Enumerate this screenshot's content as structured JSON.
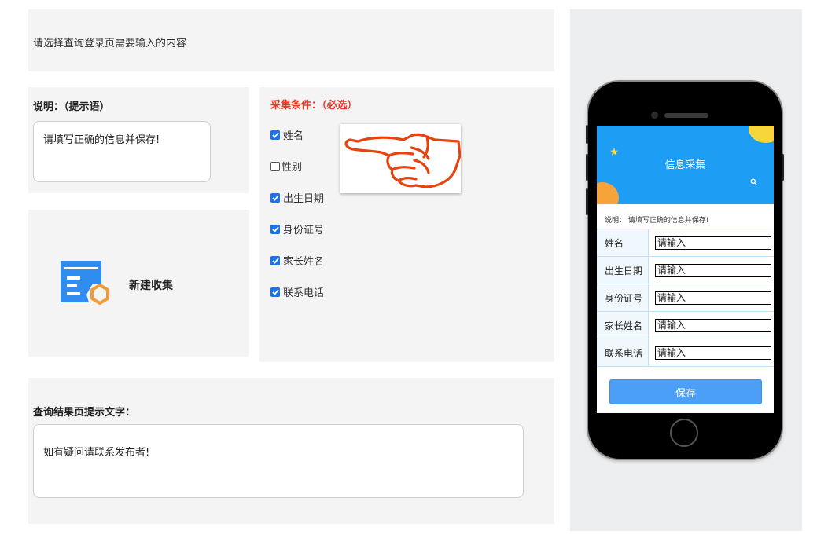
{
  "top": {
    "prompt": "请选择查询登录页需要输入的内容"
  },
  "description": {
    "label": "说明：（提示语）",
    "value": "请填写正确的信息并保存!"
  },
  "new_collection": {
    "label": "新建收集",
    "icon": "form-edit-icon"
  },
  "conditions": {
    "title": "采集条件：（必选）",
    "items": [
      {
        "label": "姓名",
        "checked": true
      },
      {
        "label": "性别",
        "checked": false
      },
      {
        "label": "出生日期",
        "checked": true
      },
      {
        "label": "身份证号",
        "checked": true
      },
      {
        "label": "家长姓名",
        "checked": true
      },
      {
        "label": "联系电话",
        "checked": true
      }
    ]
  },
  "result": {
    "label": "查询结果页提示文字：",
    "value": "如有疑问请联系发布者!"
  },
  "preview": {
    "title": "信息采集",
    "desc": "说明：  请填写正确的信息并保存!",
    "fields": [
      {
        "label": "姓名",
        "placeholder": "请输入"
      },
      {
        "label": "出生日期",
        "placeholder": "请输入"
      },
      {
        "label": "身份证号",
        "placeholder": "请输入"
      },
      {
        "label": "家长姓名",
        "placeholder": "请输入"
      },
      {
        "label": "联系电话",
        "placeholder": "请输入"
      }
    ],
    "save_label": "保存"
  },
  "colors": {
    "accent": "#1e9df5",
    "title_red": "#e8382b",
    "hand_orange": "#e8420e",
    "checkbox_blue": "#1a73e8",
    "save_blue": "#4b9ff7"
  }
}
